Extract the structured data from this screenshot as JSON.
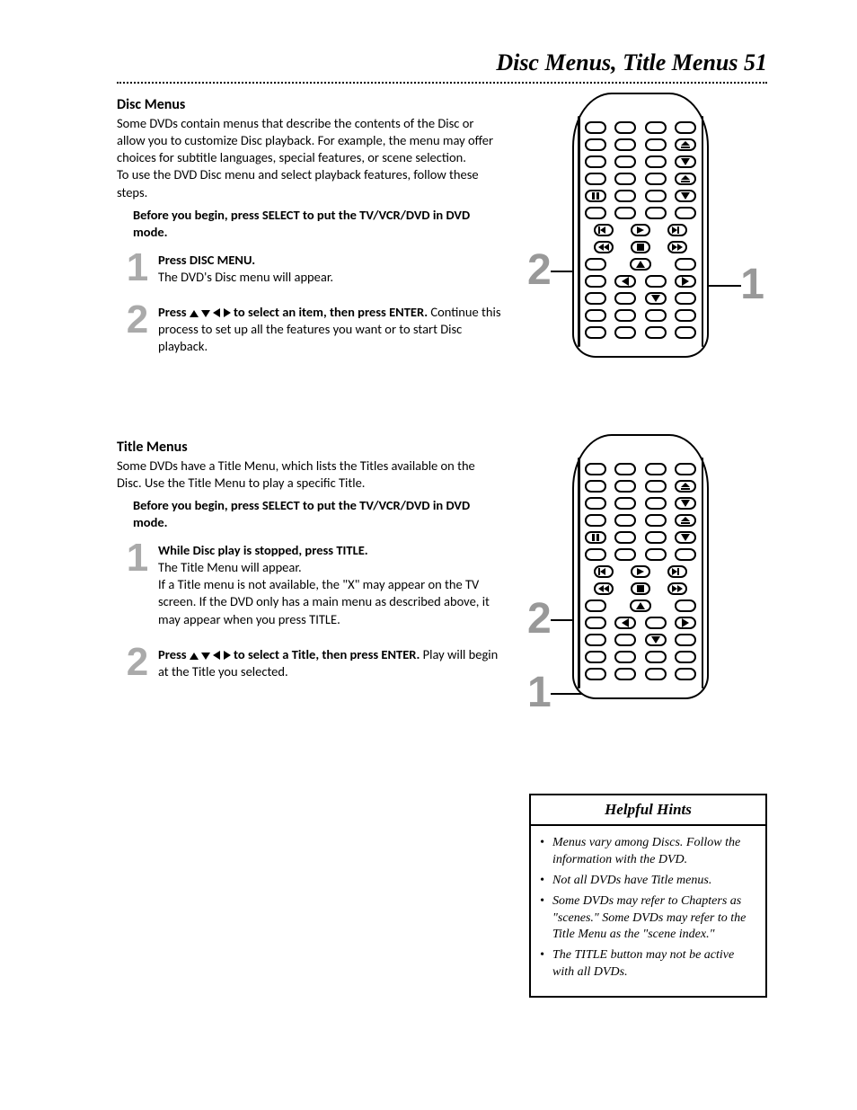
{
  "header": {
    "title": "Disc Menus, Title Menus  51"
  },
  "disc": {
    "heading": "Disc Menus",
    "intro1": "Some DVDs contain menus that describe the contents of the Disc or allow you to customize Disc playback.  For example, the menu may offer choices for subtitle languages, special features, or scene selection.",
    "intro2": "To use the DVD Disc menu and select playback features, follow these steps.",
    "preface": "Before you begin, press SELECT to put the TV/VCR/DVD in DVD mode.",
    "step1_num": "1",
    "step1_lead": "Press DISC MENU.",
    "step1_body": "The DVD's Disc menu will appear.",
    "step2_num": "2",
    "step2_lead_a": "Press ",
    "step2_lead_b": " to select an item, then press ENTER.",
    "step2_body": "  Continue this process to set up all the features you want or to start Disc playback."
  },
  "title": {
    "heading": "Title Menus",
    "intro": "Some DVDs have a Title Menu, which lists the Titles available on the Disc.  Use the Title Menu to play a specific Title.",
    "preface": "Before you begin, press SELECT to put the TV/VCR/DVD in DVD mode.",
    "step1_num": "1",
    "step1_lead": "While Disc play is stopped, press TITLE.",
    "step1_body1": "The Title Menu will appear.",
    "step1_body2": "If a Title menu is not available, the \"X\" may appear on the TV screen. If the DVD only has a main menu as described above, it may appear when you press TITLE.",
    "step2_num": "2",
    "step2_lead_a": "Press ",
    "step2_lead_b": " to select a Title, then press ENTER.",
    "step2_body": "  Play will begin at the Title you selected."
  },
  "remote1": {
    "callout_left": "2",
    "callout_right": "1"
  },
  "remote2": {
    "callout_top": "2",
    "callout_bottom": "1"
  },
  "hints": {
    "title": "Helpful Hints",
    "items": [
      "Menus vary among Discs. Follow the information with the DVD.",
      "Not all DVDs have Title menus.",
      "Some DVDs may refer to Chapters as \"scenes.\" Some DVDs may refer to the Title Menu as the \"scene index.\"",
      "The TITLE button may not be active with all DVDs."
    ]
  }
}
